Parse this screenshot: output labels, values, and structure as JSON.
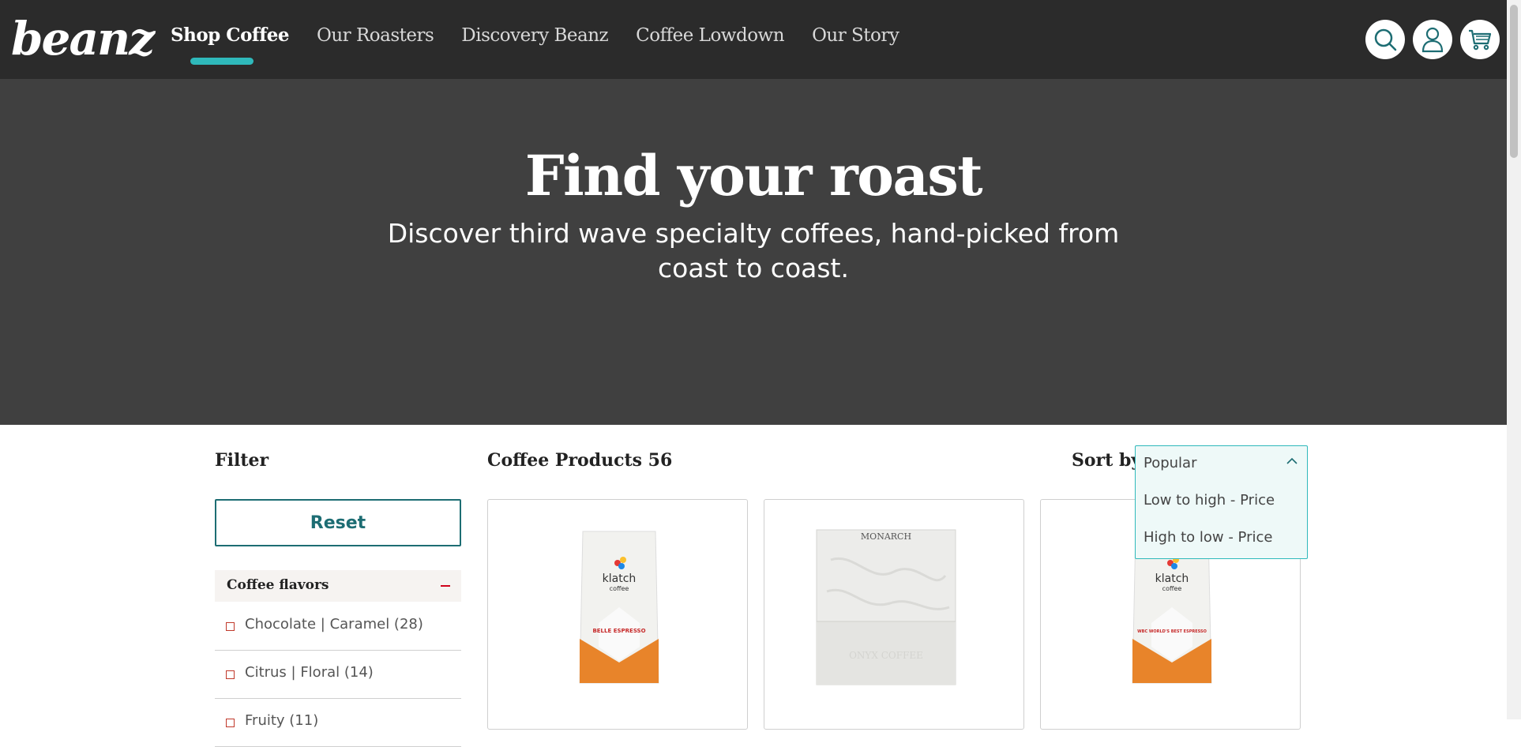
{
  "header": {
    "logo": "beanz",
    "nav": [
      {
        "label": "Shop Coffee",
        "active": true
      },
      {
        "label": "Our Roasters"
      },
      {
        "label": "Discovery Beanz"
      },
      {
        "label": "Coffee Lowdown"
      },
      {
        "label": "Our Story"
      }
    ],
    "icons": [
      "search-icon",
      "user-icon",
      "cart-icon"
    ]
  },
  "hero": {
    "title": "Find your roast",
    "subtitle": "Discover third wave specialty coffees, hand-picked from coast to coast."
  },
  "filter": {
    "title": "Filter",
    "reset_label": "Reset",
    "section_label": "Coffee flavors",
    "options": [
      {
        "label": "Chocolate | Caramel (28)"
      },
      {
        "label": "Citrus | Floral (14)"
      },
      {
        "label": "Fruity (11)"
      }
    ]
  },
  "products": {
    "title": "Coffee Products 56",
    "sort_label": "Sort by",
    "cards": [
      {
        "brand": "klatch",
        "brand_sub": "coffee",
        "product": "BELLE ESPRESSO"
      },
      {
        "brand": "MONARCH",
        "brand_sub": "ONYX COFFEE"
      },
      {
        "brand": "klatch",
        "brand_sub": "coffee",
        "product": "WBC WORLD'S BEST ESPRESSO"
      }
    ]
  },
  "sort_dropdown": {
    "selected": "Popular",
    "options": [
      "Low to high - Price",
      "High to low - Price"
    ]
  },
  "colors": {
    "header_bg": "#2b2b2b",
    "hero_bg": "#404040",
    "accent": "#2fb9bb",
    "reset": "#1d6d73"
  }
}
